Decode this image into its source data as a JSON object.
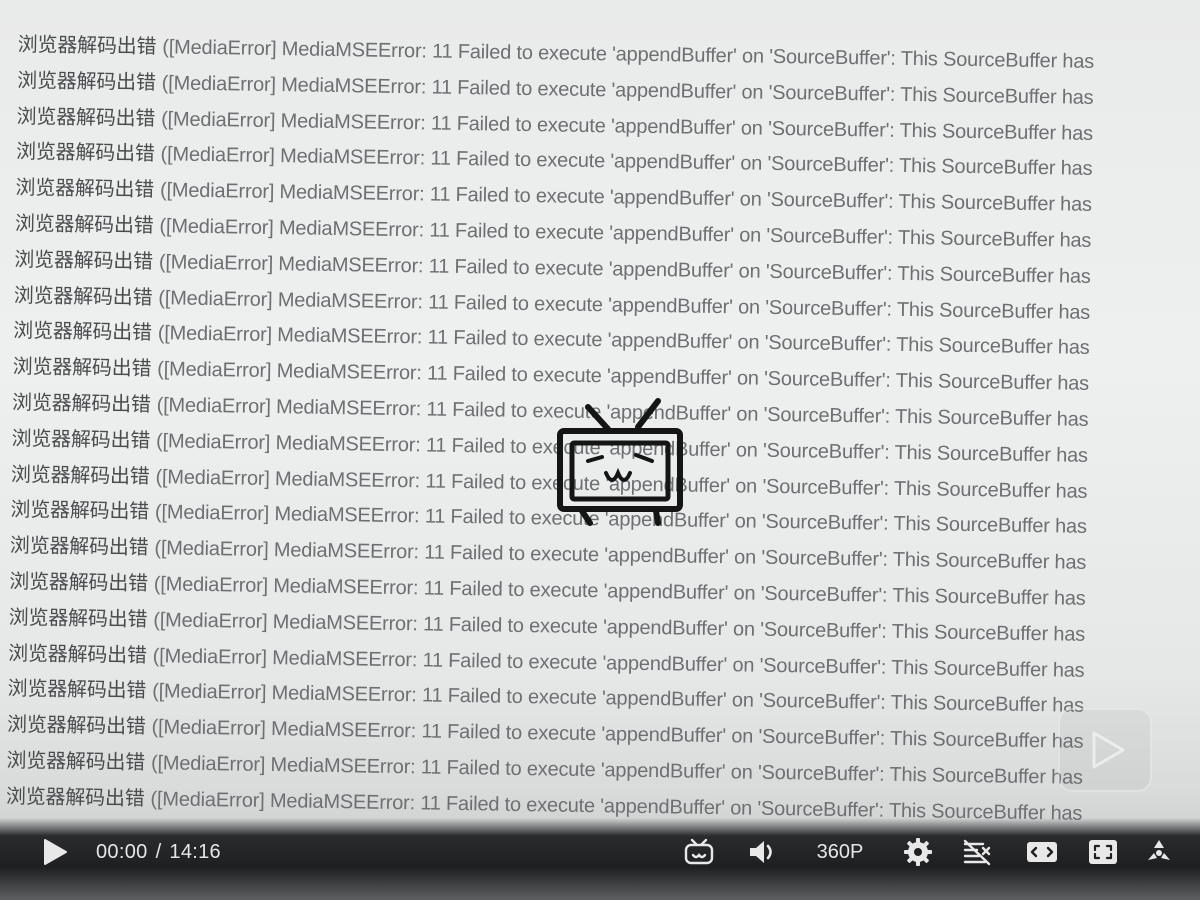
{
  "error_log": {
    "prefix": "浏览器解码出错",
    "lines": [
      "([MediaError] MediaMSEError: 11 Failed to execute 'appendBuffer' on 'SourceBuffer': This SourceBuffer has",
      "([MediaError] MediaMSEError: 11 Failed to execute 'appendBuffer' on 'SourceBuffer': This SourceBuffer has",
      "([MediaError] MediaMSEError: 11 Failed to execute 'appendBuffer' on 'SourceBuffer': This SourceBuffer has",
      "([MediaError] MediaMSEError: 11 Failed to execute 'appendBuffer' on 'SourceBuffer': This SourceBuffer has",
      "([MediaError] MediaMSEError: 11 Failed to execute 'appendBuffer' on 'SourceBuffer': This SourceBuffer has",
      "([MediaError] MediaMSEError: 11 Failed to execute 'appendBuffer' on 'SourceBuffer': This SourceBuffer has",
      "([MediaError] MediaMSEError: 11 Failed to execute 'appendBuffer' on 'SourceBuffer': This SourceBuffer has",
      "([MediaError] MediaMSEError: 11 Failed to execute 'appendBuffer' on 'SourceBuffer': This SourceBuffer has",
      "([MediaError] MediaMSEError: 11 Failed to execute 'appendBuffer' on 'SourceBuffer': This SourceBuffer has",
      "([MediaError] MediaMSEError: 11 Failed to execute 'appendBuffer' on 'SourceBuffer': This SourceBuffer has",
      "([MediaError] MediaMSEError: 11 Failed to execute 'appendBuffer' on 'SourceBuffer': This SourceBuffer has",
      "([MediaError] MediaMSEError: 11 Failed to execute 'appendBuffer' on 'SourceBuffer': This SourceBuffer has",
      "([MediaError] MediaMSEError: 11 Failed to execute 'appendBuffer' on 'SourceBuffer': This SourceBuffer has",
      "([MediaError] MediaMSEError: 11 Failed to execute 'appendBuffer' on 'SourceBuffer': This SourceBuffer has",
      "([MediaError] MediaMSEError: 11 Failed to execute 'appendBuffer' on 'SourceBuffer': This SourceBuffer has",
      "([MediaError] MediaMSEError: 11 Failed to execute 'appendBuffer' on 'SourceBuffer': This SourceBuffer has",
      "([MediaError] MediaMSEError: 11 Failed to execute 'appendBuffer' on 'SourceBuffer': This SourceBuffer has",
      "([MediaError] MediaMSEError: 11 Failed to execute 'appendBuffer' on 'SourceBuffer': This SourceBuffer has",
      "([MediaError] MediaMSEError: 11 Failed to execute 'appendBuffer' on 'SourceBuffer': This SourceBuffer has",
      "([MediaError] MediaMSEError: 11 Failed to execute 'appendBuffer' on 'SourceBuffer': This SourceBuffer has",
      "([MediaError] MediaMSEError: 11 Failed to execute 'appendBuffer' on 'SourceBuffer': This SourceBuffer has",
      "([MediaError] MediaMSEError: 11 Failed to execute 'appendBuffer' on 'SourceBuffer': This SourceBuffer has"
    ]
  },
  "loading_indicator": {
    "icon": "tv-mascot-icon"
  },
  "overlay": {
    "icon": "play-icon"
  },
  "controls": {
    "current_time": "00:00",
    "separator": "/",
    "duration": "14:16",
    "quality": "360P",
    "icons": {
      "play": "play-icon",
      "danmaku": "tv-danmaku-icon",
      "volume": "speaker-icon",
      "settings": "gear-icon",
      "danmaku_off": "danmaku-off-icon",
      "widescreen": "widescreen-icon",
      "web_fullscreen": "web-fullscreen-icon",
      "fullscreen": "fullscreen-icon"
    }
  },
  "colors": {
    "log_text": "#6d7072",
    "prefix_text": "#4a4c4e",
    "control_bar": "#1e1f21",
    "control_text": "#e6e6e6"
  }
}
